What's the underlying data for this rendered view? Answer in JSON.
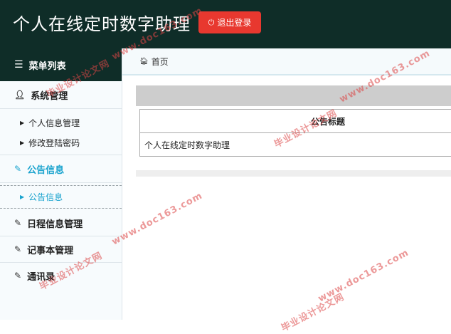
{
  "header": {
    "title": "个人在线定时数字助理",
    "logout_label": "退出登录"
  },
  "sidebar": {
    "menu_title": "菜单列表",
    "groups": [
      {
        "label": "系统管理"
      },
      {
        "label": "公告信息"
      },
      {
        "label": "日程信息管理"
      },
      {
        "label": "记事本管理"
      },
      {
        "label": "通讯录"
      }
    ],
    "system_items": [
      "个人信息管理",
      "修改登陆密码"
    ],
    "notice_items": [
      "公告信息"
    ]
  },
  "breadcrumb": {
    "home": "首页"
  },
  "table": {
    "headers": [
      "公告标题"
    ],
    "rows": [
      [
        "个人在线定时数字助理"
      ]
    ]
  },
  "watermark": {
    "text": "毕业设计论文网",
    "url": "www.doc163.com"
  },
  "colors": {
    "header_bg": "#0f2d28",
    "logout_bg": "#e8382f",
    "accent": "#1aa3ce"
  }
}
